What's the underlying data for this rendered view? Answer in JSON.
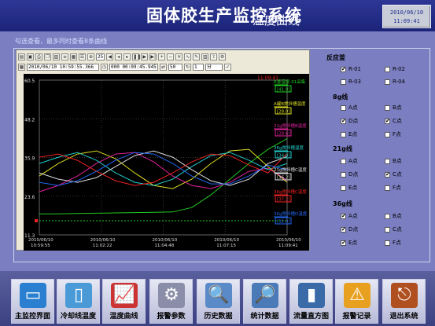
{
  "header": {
    "title": "固体胶生产监控系统",
    "subtitle": "温度曲线",
    "date": "2010/06/10",
    "time": "11:09:41"
  },
  "hint": "勾选查看，最多同时查看8条曲线",
  "toolbar": {
    "spin1": "25",
    "start_time": "2010/06/10 10:59:55.366",
    "duration": "000 00:09:45.945",
    "spin2": "50",
    "spin3": "1",
    "unit": "分"
  },
  "chart_data": {
    "type": "line",
    "y_ticks": [
      "60.5",
      "48.2",
      "35.9",
      "23.6",
      "11.3"
    ],
    "x_ticks": [
      {
        "date": "2010/06/10",
        "time": "10:59:55"
      },
      {
        "date": "2010/06/10",
        "time": "11:02:22"
      },
      {
        "date": "2010/06/10",
        "time": "11:04:48"
      },
      {
        "date": "2010/06/10",
        "time": "11:07:15"
      },
      {
        "date": "2010/06/10",
        "time": "11:09:41"
      }
    ],
    "top_right_time": "11:09:41",
    "ylim": [
      11.3,
      60.5
    ],
    "legend": [
      {
        "name": "R釜温度-01采集",
        "value": "[41.9]",
        "color": "#22cc22"
      },
      {
        "name": "A罐B搅拌槽温度",
        "value": "[28.0]",
        "color": "#dddd22"
      },
      {
        "name": "21g搅拌槽B温度",
        "value": "[28.6]",
        "color": "#dd2299"
      },
      {
        "name": "36g搅拌槽温度",
        "value": "[34.0]",
        "color": "#22cccc"
      },
      {
        "name": "21g搅拌槽C温度",
        "value": "[36.2]",
        "color": "#dddddd"
      },
      {
        "name": "36g搅拌槽C温度",
        "value": "[37.2]",
        "color": "#ee2222"
      },
      {
        "name": "36g搅拌槽D温度",
        "value": "[32.0]",
        "color": "#2266ee"
      }
    ],
    "series": [
      {
        "color": "#22cc22",
        "values": [
          18.0,
          18.0,
          18.1,
          18.2,
          18.3,
          18.4,
          18.5,
          18.6,
          20.0,
          24.0,
          29.0,
          34.0,
          38.5,
          41.9
        ]
      },
      {
        "color": "#dddd22",
        "values": [
          30.0,
          34.0,
          37.0,
          38.0,
          35.5,
          31.0,
          27.0,
          26.0,
          29.0,
          34.0,
          38.0,
          38.5,
          33.0,
          28.0
        ]
      },
      {
        "color": "#dd2299",
        "values": [
          25.0,
          27.0,
          30.0,
          34.0,
          37.0,
          37.5,
          34.5,
          30.0,
          27.0,
          26.0,
          28.0,
          31.5,
          32.5,
          28.6
        ]
      },
      {
        "color": "#22cccc",
        "values": [
          34.0,
          36.0,
          37.5,
          35.0,
          31.0,
          28.0,
          27.0,
          29.0,
          33.0,
          36.5,
          37.5,
          35.0,
          32.0,
          34.0
        ]
      },
      {
        "color": "#dddddd",
        "values": [
          31.0,
          29.0,
          28.0,
          29.5,
          33.0,
          36.5,
          38.0,
          36.0,
          32.0,
          28.5,
          27.0,
          29.0,
          34.0,
          36.2
        ]
      },
      {
        "color": "#ee2222",
        "values": [
          36.0,
          37.0,
          35.0,
          31.5,
          28.5,
          27.0,
          28.0,
          31.0,
          34.5,
          37.0,
          36.5,
          33.5,
          31.0,
          37.2
        ]
      },
      {
        "color": "#2266ee",
        "values": [
          28.0,
          27.0,
          28.5,
          31.5,
          35.0,
          37.5,
          37.0,
          34.0,
          30.0,
          27.5,
          27.5,
          30.0,
          33.5,
          32.0
        ]
      }
    ]
  },
  "selection": {
    "reaction_title": "反应釜",
    "reaction": [
      {
        "label": "R-01",
        "checked": true
      },
      {
        "label": "R-02",
        "checked": false
      },
      {
        "label": "R-03",
        "checked": false
      },
      {
        "label": "R-04",
        "checked": false
      }
    ],
    "line8_title": "8g线",
    "line8": [
      {
        "label": "A点",
        "checked": false
      },
      {
        "label": "B点",
        "checked": false
      },
      {
        "label": "D点",
        "checked": true
      },
      {
        "label": "C点",
        "checked": true
      },
      {
        "label": "E点",
        "checked": false
      },
      {
        "label": "F点",
        "checked": false
      }
    ],
    "line21_title": "21g线",
    "line21": [
      {
        "label": "A点",
        "checked": false
      },
      {
        "label": "B点",
        "checked": false
      },
      {
        "label": "D点",
        "checked": false
      },
      {
        "label": "C点",
        "checked": true
      },
      {
        "label": "E点",
        "checked": false
      },
      {
        "label": "F点",
        "checked": false
      }
    ],
    "line36_title": "36g线",
    "line36": [
      {
        "label": "A点",
        "checked": true
      },
      {
        "label": "B点",
        "checked": false
      },
      {
        "label": "D点",
        "checked": true
      },
      {
        "label": "C点",
        "checked": false
      },
      {
        "label": "E点",
        "checked": true
      },
      {
        "label": "F点",
        "checked": false
      }
    ]
  },
  "nav": [
    {
      "label": "主监控界面",
      "icon": "monitor-icon",
      "color": "#2a7fd0"
    },
    {
      "label": "冷却线温度",
      "icon": "display-icon",
      "color": "#4a9ad8"
    },
    {
      "label": "温度曲线",
      "icon": "chart-icon",
      "color": "#cc3333"
    },
    {
      "label": "报警参数",
      "icon": "gear-icon",
      "color": "#8a8ea8"
    },
    {
      "label": "历史数据",
      "icon": "magnifier-icon",
      "color": "#5a8ac8"
    },
    {
      "label": "统计数据",
      "icon": "magnifier-doc-icon",
      "color": "#4a7ab8"
    },
    {
      "label": "流量直方图",
      "icon": "histogram-icon",
      "color": "#3a6aa8"
    },
    {
      "label": "报警记录",
      "icon": "warning-icon",
      "color": "#e8a020"
    },
    {
      "label": "退出系统",
      "icon": "exit-icon",
      "color": "#b05020"
    }
  ]
}
